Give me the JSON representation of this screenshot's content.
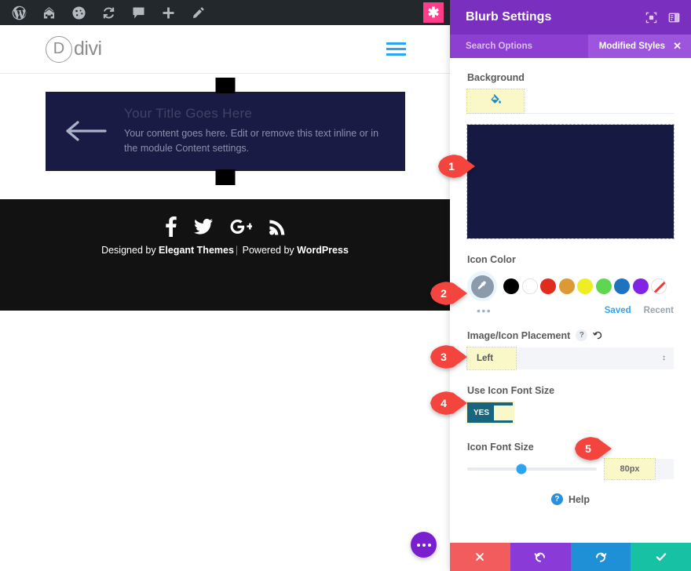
{
  "adminbar": {
    "icons": [
      "wordpress-logo-icon",
      "home-icon",
      "dashboard-icon",
      "refresh-icon",
      "comment-icon",
      "plus-icon",
      "pencil-icon"
    ],
    "right_badge": "✱"
  },
  "site": {
    "logo_letter": "D",
    "logo_text": "divi",
    "menu_icon": "hamburger-menu-icon"
  },
  "module": {
    "icon": "arrow-left-icon",
    "title": "Your Title Goes Here",
    "body": "Your content goes here. Edit or remove this text inline or in the module Content settings."
  },
  "footer": {
    "social": [
      "facebook-icon",
      "twitter-icon",
      "googleplus-icon",
      "rss-icon"
    ],
    "credit_prefix": "Designed by ",
    "credit_brand": "Elegant Themes",
    "credit_separator": "|",
    "credit_middle": " Powered by ",
    "credit_platform": "WordPress"
  },
  "fab": {
    "name": "more-options-button"
  },
  "panel": {
    "title": "Blurb Settings",
    "head_icons": [
      "focus-target-icon",
      "panel-layout-icon"
    ],
    "search_placeholder": "Search Options",
    "modified_pill": "Modified Styles",
    "modified_close": "✕",
    "background": {
      "label": "Background",
      "tab_icon": "paint-bucket-icon",
      "preview_color": "#161a42"
    },
    "icon_color": {
      "label": "Icon Color",
      "picker_icon": "eyedropper-icon",
      "swatches": [
        "#000000",
        "#ffffff",
        "#e02b20",
        "#dd9933",
        "#eeee22",
        "#5fd64f",
        "#1e73be",
        "#8224e3",
        "transparent"
      ],
      "more_dots": "•••",
      "saved_label": "Saved",
      "recent_label": "Recent"
    },
    "placement": {
      "label": "Image/Icon Placement",
      "help_icon": "question-mark-icon",
      "reset_icon": "reset-icon",
      "value": "Left",
      "caret": "↕"
    },
    "use_icon_font_size": {
      "label": "Use Icon Font Size",
      "toggle_state": "YES"
    },
    "icon_font_size": {
      "label": "Icon Font Size",
      "value": "80px",
      "slider_percent": 42
    },
    "help": {
      "icon": "question-circle-icon",
      "label": "Help"
    },
    "footer_buttons": [
      {
        "name": "cancel-button",
        "glyph": "✕",
        "color": "#f25c5c"
      },
      {
        "name": "undo-button",
        "glyph": "↺",
        "color": "#8a3ad6"
      },
      {
        "name": "redo-button",
        "glyph": "↻",
        "color": "#1f8fd6"
      },
      {
        "name": "save-button",
        "glyph": "✓",
        "color": "#16c2a3"
      }
    ]
  },
  "markers": [
    {
      "number": "1"
    },
    {
      "number": "2"
    },
    {
      "number": "3"
    },
    {
      "number": "4"
    },
    {
      "number": "5"
    }
  ]
}
